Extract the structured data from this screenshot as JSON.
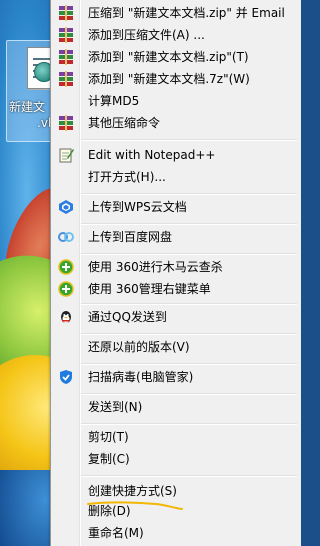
{
  "desktop": {
    "file_label_line1": "新建文",
    "file_label_line2": ".vb"
  },
  "menu": {
    "items": [
      {
        "label": "压缩到 \"新建文本文档.zip\" 并 Email",
        "icon": "winrar-books-icon"
      },
      {
        "label": "添加到压缩文件(A) ...",
        "icon": "winrar-books-icon"
      },
      {
        "label": "添加到 \"新建文本文档.zip\"(T)",
        "icon": "winrar-books-icon"
      },
      {
        "label": "添加到 \"新建文本文档.7z\"(W)",
        "icon": "winrar-books-icon"
      },
      {
        "label": "计算MD5",
        "icon": ""
      },
      {
        "label": "其他压缩命令",
        "icon": "winrar-books-icon"
      },
      {
        "label": "Edit with Notepad++",
        "icon": "notepadpp-icon"
      },
      {
        "label": "打开方式(H)...",
        "icon": ""
      },
      {
        "label": "上传到WPS云文档",
        "icon": "wps-cloud-icon"
      },
      {
        "label": "上传到百度网盘",
        "icon": "baidu-netdisk-icon"
      },
      {
        "label": "使用 360进行木马云查杀",
        "icon": "360-icon"
      },
      {
        "label": "使用 360管理右键菜单",
        "icon": "360-icon"
      },
      {
        "label": "通过QQ发送到",
        "icon": "qq-penguin-icon"
      },
      {
        "label": "还原以前的版本(V)",
        "icon": ""
      },
      {
        "label": "扫描病毒(电脑管家)",
        "icon": "tencent-shield-icon"
      },
      {
        "label": "发送到(N)",
        "icon": ""
      },
      {
        "label": "剪切(T)",
        "icon": ""
      },
      {
        "label": "复制(C)",
        "icon": ""
      },
      {
        "label": "创建快捷方式(S)",
        "icon": ""
      },
      {
        "label": "删除(D)",
        "icon": ""
      },
      {
        "label": "重命名(M)",
        "icon": ""
      }
    ]
  },
  "colors": {
    "menu_bg": "#f0f0f0",
    "highlight_underline": "#f2b705"
  }
}
